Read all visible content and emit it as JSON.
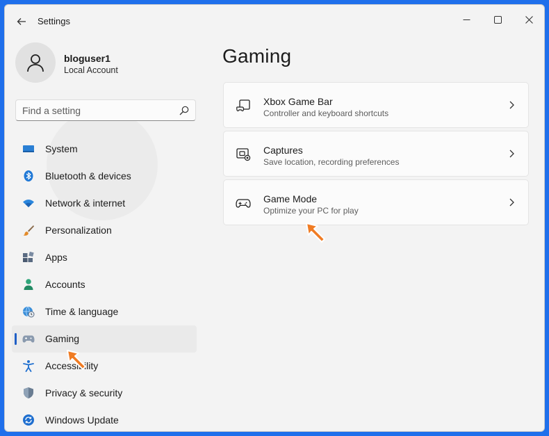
{
  "window": {
    "title": "Settings"
  },
  "profile": {
    "name": "bloguser1",
    "account_type": "Local Account"
  },
  "search": {
    "placeholder": "Find a setting"
  },
  "sidebar": {
    "items": [
      {
        "label": "System",
        "icon": "monitor-icon",
        "active": false
      },
      {
        "label": "Bluetooth & devices",
        "icon": "bluetooth-icon",
        "active": false
      },
      {
        "label": "Network & internet",
        "icon": "wifi-icon",
        "active": false
      },
      {
        "label": "Personalization",
        "icon": "brush-icon",
        "active": false
      },
      {
        "label": "Apps",
        "icon": "apps-icon",
        "active": false
      },
      {
        "label": "Accounts",
        "icon": "person-icon",
        "active": false
      },
      {
        "label": "Time & language",
        "icon": "globe-clock-icon",
        "active": false
      },
      {
        "label": "Gaming",
        "icon": "controller-icon",
        "active": true
      },
      {
        "label": "Accessibility",
        "icon": "accessibility-icon",
        "active": false
      },
      {
        "label": "Privacy & security",
        "icon": "shield-icon",
        "active": false
      },
      {
        "label": "Windows Update",
        "icon": "update-icon",
        "active": false
      }
    ]
  },
  "main": {
    "title": "Gaming",
    "cards": [
      {
        "title": "Xbox Game Bar",
        "subtitle": "Controller and keyboard shortcuts",
        "icon": "game-bar-icon"
      },
      {
        "title": "Captures",
        "subtitle": "Save location, recording preferences",
        "icon": "capture-icon"
      },
      {
        "title": "Game Mode",
        "subtitle": "Optimize your PC for play",
        "icon": "controller-icon"
      }
    ]
  },
  "colors": {
    "accent": "#1f5fc6",
    "arrow": "#f07c24",
    "background": "#f3f3f3"
  }
}
